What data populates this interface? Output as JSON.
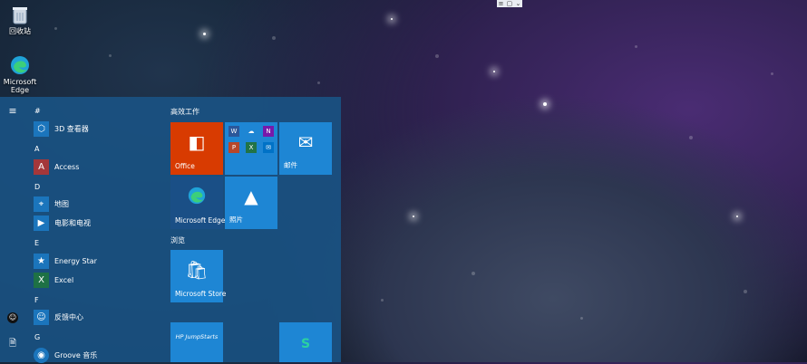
{
  "desktop": {
    "recycle_bin_label": "回收站",
    "edge_label": "Microsoft Edge"
  },
  "top_menu": {
    "glyph_a": "≡",
    "glyph_b": "▢",
    "glyph_c": "⌄"
  },
  "rail": {
    "menu": "≡",
    "user": "☺",
    "document": "🗎",
    "settings": "⚙"
  },
  "app_list": {
    "letters": [
      "#",
      "A",
      "D",
      "E",
      "F",
      "G"
    ],
    "items": [
      {
        "label": "3D 查看器",
        "icon": "3d-viewer-icon",
        "glyph": "⬡",
        "color": "#1b75bc"
      },
      {
        "label": "Access",
        "icon": "access-icon",
        "glyph": "A",
        "color": "#a4373a"
      },
      {
        "label": "地图",
        "icon": "map-icon",
        "glyph": "⌖",
        "color": "#1b75bc"
      },
      {
        "label": "电影和电视",
        "icon": "film-icon",
        "glyph": "▶",
        "color": "#1b75bc"
      },
      {
        "label": "Energy Star",
        "icon": "energy-star-icon",
        "glyph": "★",
        "color": "#1b75bc"
      },
      {
        "label": "Excel",
        "icon": "excel-icon",
        "glyph": "X",
        "color": "#1e7145"
      },
      {
        "label": "反馈中心",
        "icon": "feedback-icon",
        "glyph": "☺",
        "color": "#1b75bc"
      },
      {
        "label": "Groove 音乐",
        "icon": "groove-music-icon",
        "glyph": "◉",
        "color": "#1b75bc"
      }
    ]
  },
  "tiles": {
    "group1_title": "高效工作",
    "group2_title": "浏览",
    "office": {
      "label": "Office",
      "glyph": "◧",
      "color": "#d83b01"
    },
    "multi": {
      "color": "#1e86d4",
      "minis": [
        "W",
        "☁",
        "N",
        "P",
        "X",
        "✉"
      ]
    },
    "mail": {
      "label": "邮件",
      "glyph": "✉",
      "color": "#1e86d4"
    },
    "edge": {
      "label": "Microsoft Edge",
      "glyph": "◐",
      "color": "#1a4f86"
    },
    "photos": {
      "label": "照片",
      "glyph": "▲",
      "color": "#1e86d4"
    },
    "store": {
      "label": "Microsoft Store",
      "glyph": "🛍",
      "color": "#1e86d4"
    },
    "hp": {
      "label": "HP JumpStarts",
      "glyph": "hp",
      "color": "#1e86d4"
    },
    "s_app": {
      "label": "",
      "glyph": "S",
      "color": "#1e86d4"
    }
  }
}
